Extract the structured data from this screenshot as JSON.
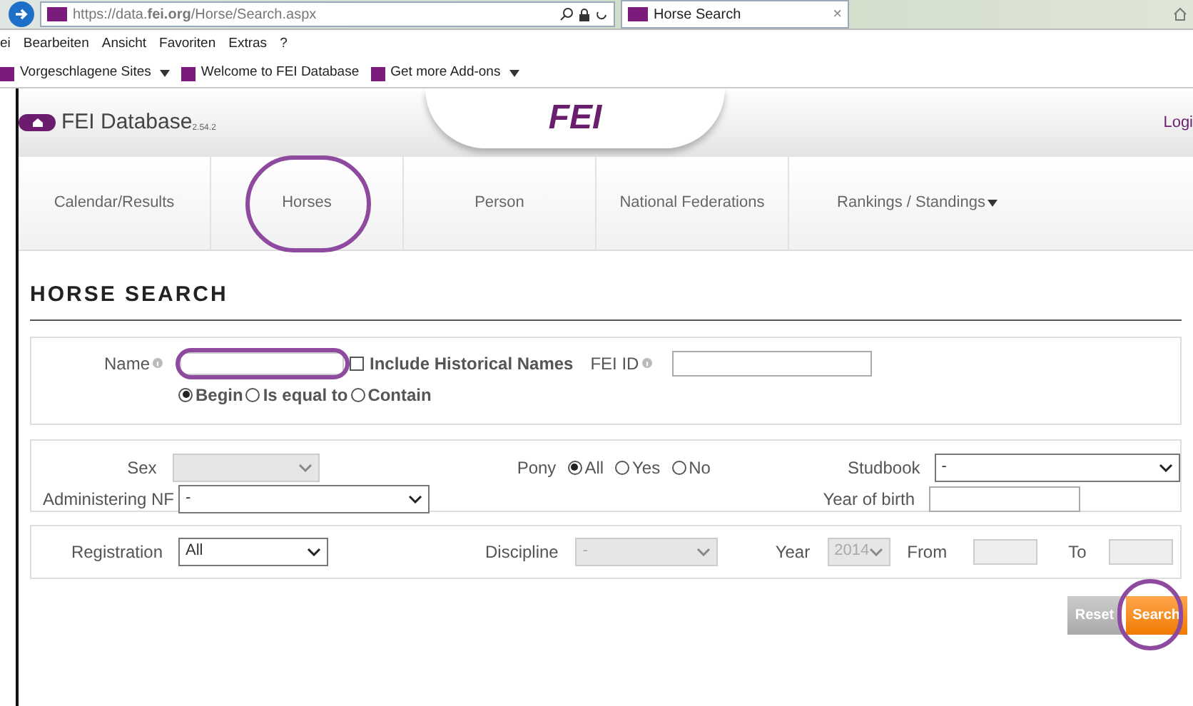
{
  "browser": {
    "url": "https://data.**fei.org**/Horse/Search.aspx",
    "tab_title": "Horse Search",
    "tab_close": "×",
    "menu": [
      "ei",
      "Bearbeiten",
      "Ansicht",
      "Favoriten",
      "Extras",
      "?"
    ],
    "favorites": [
      {
        "label": "Vorgeschlagene Sites",
        "dropdown": true
      },
      {
        "label": "Welcome to FEI Database",
        "dropdown": false
      },
      {
        "label": "Get more Add-ons",
        "dropdown": true
      }
    ]
  },
  "site": {
    "title": "FEI Database",
    "version": "2.54.2",
    "logo": "FEI",
    "login": "Logi",
    "nav": [
      {
        "label": "Calendar/Results",
        "dropdown": false,
        "circled": false
      },
      {
        "label": "Horses",
        "dropdown": false,
        "circled": true
      },
      {
        "label": "Person",
        "dropdown": false,
        "circled": false
      },
      {
        "label": "National Federations",
        "dropdown": false,
        "circled": false
      },
      {
        "label": "Rankings / Standings",
        "dropdown": true,
        "circled": false
      }
    ]
  },
  "heading": "HORSE SEARCH",
  "name_section": {
    "name_label": "Name",
    "include_historical": {
      "label": "Include Historical Names",
      "checked": false
    },
    "fei_id_label": "FEI ID",
    "match_options": [
      {
        "label": "Begin",
        "selected": true
      },
      {
        "label": "Is equal to",
        "selected": false
      },
      {
        "label": "Contain",
        "selected": false
      }
    ]
  },
  "details_section": {
    "sex_label": "Sex",
    "pony_label": "Pony",
    "pony_options": [
      {
        "label": "All",
        "selected": true
      },
      {
        "label": "Yes",
        "selected": false
      },
      {
        "label": "No",
        "selected": false
      }
    ],
    "studbook_label": "Studbook",
    "studbook_value": "-",
    "nf_label": "Administering NF",
    "nf_value": "-",
    "year_of_birth_label": "Year of birth"
  },
  "registration_section": {
    "registration_label": "Registration",
    "registration_value": "All",
    "discipline_label": "Discipline",
    "discipline_value": "-",
    "discipline_disabled": true,
    "year_label": "Year",
    "year_value": "2014",
    "year_disabled": true,
    "from_label": "From",
    "to_label": "To"
  },
  "buttons": [
    {
      "label": "Reset",
      "kind": "secondary",
      "circled": false
    },
    {
      "label": "Search",
      "kind": "primary",
      "circled": true
    }
  ]
}
